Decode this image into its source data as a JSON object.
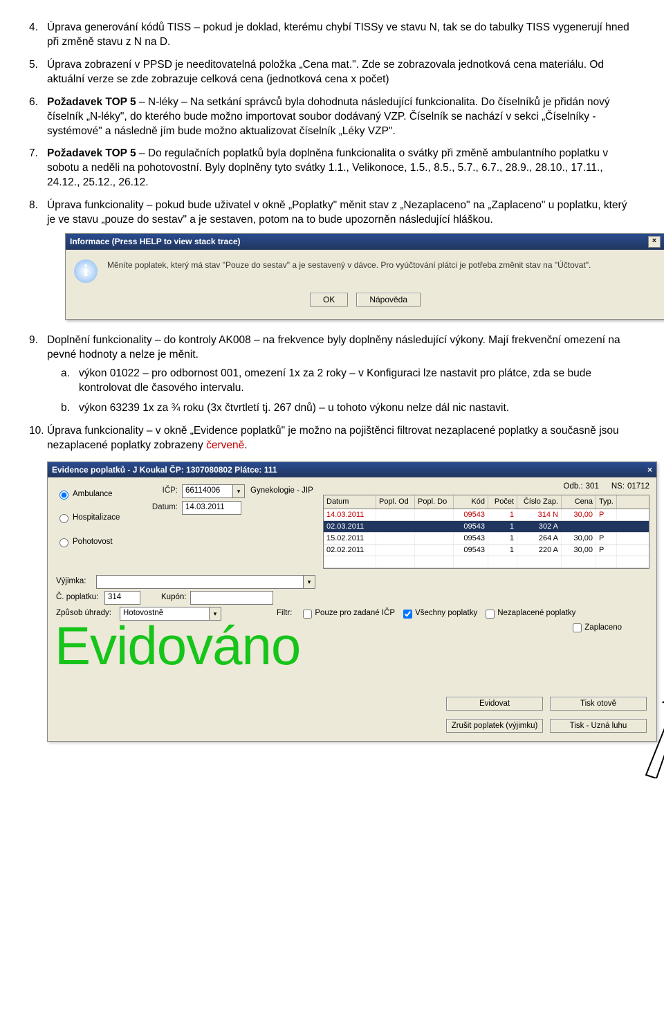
{
  "items": {
    "i4": {
      "num": "4.",
      "text": "Úprava generování kódů TISS – pokud je doklad, kterému chybí TISSy ve stavu N, tak se do tabulky TISS vygenerují hned při změně stavu z N na D."
    },
    "i5": {
      "num": "5.",
      "text": "Úprava zobrazení v PPSD je needitovatelná položka „Cena mat.\". Zde se zobrazovala jednotková cena materiálu. Od aktuální verze se zde zobrazuje celková cena (jednotková cena x počet)"
    },
    "i6": {
      "num": "6.",
      "bold": "Požadavek TOP 5",
      "text": " – N-léky – Na setkání správců byla dohodnuta následující funkcionalita. Do číselníků je přidán nový číselník „N-léky\", do kterého bude možno importovat soubor dodávaný VZP. Číselník se nachází v sekci „Číselníky - systémové\" a následně jím bude možno aktualizovat číselník „Léky VZP\"."
    },
    "i7": {
      "num": "7.",
      "bold": "Požadavek TOP 5",
      "text": " – Do regulačních poplatků byla doplněna funkcionalita o svátky při změně ambulantního poplatku v sobotu a neděli na pohotovostní. Byly doplněny tyto svátky 1.1., Velikonoce, 1.5., 8.5., 5.7., 6.7., 28.9., 28.10., 17.11., 24.12., 25.12., 26.12."
    },
    "i8": {
      "num": "8.",
      "text": "Úprava funkcionality – pokud bude uživatel v okně „Poplatky\" měnit stav z „Nezaplaceno\" na „Zaplaceno\" u poplatku, který je ve stavu „pouze do sestav\" a je sestaven, potom na to bude upozorněn následující hláškou."
    },
    "i9": {
      "num": "9.",
      "text": "Doplnění funkcionality – do kontroly AK008 – na frekvence byly doplněny následující výkony. Mají frekvenční omezení na pevné hodnoty a nelze je měnit."
    },
    "i9a": {
      "num": "a.",
      "text": "výkon 01022 – pro odbornost 001, omezení 1x za 2 roky – v Konfiguraci lze nastavit pro plátce, zda se bude kontrolovat dle časového intervalu."
    },
    "i9b": {
      "num": "b.",
      "text": "výkon 63239 1x za ¾ roku (3x čtvrtletí tj. 267 dnů) – u tohoto výkonu nelze dál nic nastavit."
    },
    "i10": {
      "num": "10.",
      "text": "Úprava funkcionality – v okně „Evidence poplatků\" je možno na pojištěnci filtrovat nezaplacené poplatky a současně jsou nezaplacené poplatky zobrazeny ",
      "red": "červeně",
      "text2": "."
    }
  },
  "dialog1": {
    "title": "Informace (Press HELP to view stack trace)",
    "msg": "Měníte poplatek, který má stav \"Pouze do sestav\" a je sestavený v dávce. Pro vyúčtování plátci je potřeba změnit stav na \"Účtovat\".",
    "ok": "OK",
    "help": "Nápověda"
  },
  "app": {
    "title": "Evidence poplatků - J Koukal  ČP: 1307080802  Plátce: 111",
    "radios": {
      "amb": "Ambulance",
      "hosp": "Hospitalizace",
      "poh": "Pohotovost"
    },
    "labels": {
      "icp": "IČP:",
      "datum": "Datum:",
      "vyjimka": "Výjimka:",
      "cpop": "Č. poplatku:",
      "kupon": "Kupón:",
      "zpusob": "Způsob úhrady:",
      "filtr": "Filtr:",
      "odb": "Odb.:",
      "ns": "NS:"
    },
    "vals": {
      "icp": "66114006",
      "spec": "Gynekologie - JIP",
      "datum": "14.03.2011",
      "cpop": "314",
      "zpusob": "Hotovostně",
      "odb": "301",
      "ns": "01712"
    },
    "checks": {
      "pouze": "Pouze pro zadané IČP",
      "vsech": "Všechny poplatky",
      "nezap": "Nezaplacené poplatky",
      "zapl": "Zaplaceno"
    },
    "th": {
      "datum": "Datum",
      "od": "Popl. Od",
      "do": "Popl. Do",
      "kod": "Kód",
      "poc": "Počet",
      "zap": "Číslo Zap.",
      "cena": "Cena",
      "typ": "Typ."
    },
    "rows": [
      {
        "d": "14.03.2011",
        "od": "",
        "do": "",
        "k": "09543",
        "p": "1",
        "z": "314 N",
        "c": "30,00",
        "t": "P"
      },
      {
        "d": "02.03.2011",
        "od": "",
        "do": "",
        "k": "09543",
        "p": "1",
        "z": "302 A",
        "c": "",
        "t": ""
      },
      {
        "d": "15.02.2011",
        "od": "",
        "do": "",
        "k": "09543",
        "p": "1",
        "z": "264 A",
        "c": "30,00",
        "t": "P"
      },
      {
        "d": "02.02.2011",
        "od": "",
        "do": "",
        "k": "09543",
        "p": "1",
        "z": "220 A",
        "c": "30,00",
        "t": "P"
      }
    ],
    "buttons": {
      "evid": "Evidovat",
      "tisk": "Tisk        otově",
      "zrus": "Zrušit poplatek (výjimku)",
      "uzn": "Tisk - Uzná     luhu"
    },
    "watermark": "Evidováno"
  }
}
